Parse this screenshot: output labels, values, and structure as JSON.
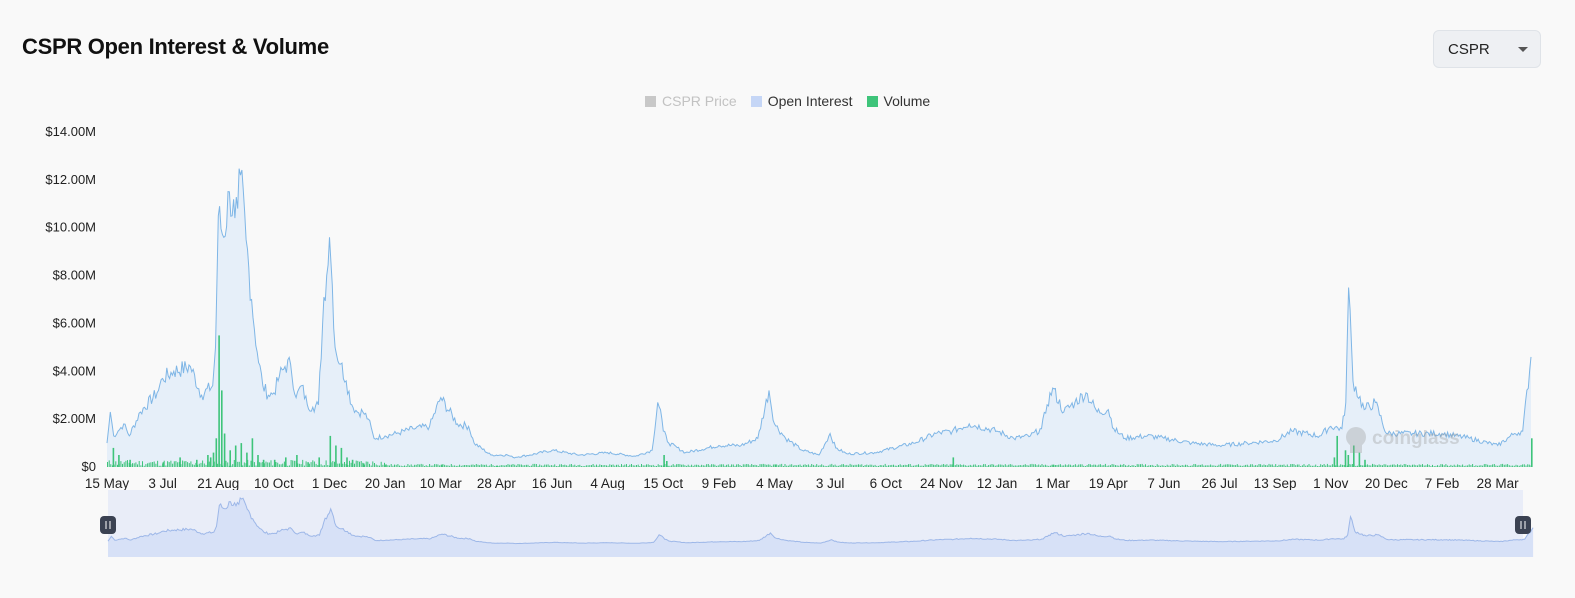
{
  "header": {
    "title": "CSPR Open Interest & Volume"
  },
  "selector": {
    "value": "CSPR"
  },
  "colors": {
    "open_interest_line": "#7fb6e6",
    "open_interest_fill": "#e6eff9",
    "volume": "#3ec47a",
    "price_disabled": "#c8c8c8",
    "legend_oi_swatch": "#c5d6f6",
    "navigator_fill": "#d7e1f7",
    "navigator_bg": "#e9edf8",
    "navigator_handle": "#3b4252"
  },
  "watermark": {
    "text": "coinglass",
    "icon": "coinglass-logo-icon"
  },
  "chart_data": {
    "type": "area",
    "title": "CSPR Open Interest & Volume",
    "legend": {
      "placement": "top-center",
      "items": [
        {
          "label": "CSPR Price",
          "color": "#c8c8c8",
          "visible": false
        },
        {
          "label": "Open Interest",
          "color": "#c5d6f6",
          "visible": true
        },
        {
          "label": "Volume",
          "color": "#3ec47a",
          "visible": true
        }
      ]
    },
    "y_axis": {
      "ticks": [
        "$0",
        "$2.00M",
        "$4.00M",
        "$6.00M",
        "$8.00M",
        "$10.00M",
        "$12.00M",
        "$14.00M"
      ],
      "ylim": [
        0,
        14000000
      ]
    },
    "x_axis": {
      "ticks": [
        "15 May",
        "3 Jul",
        "21 Aug",
        "10 Oct",
        "1 Dec",
        "20 Jan",
        "10 Mar",
        "28 Apr",
        "16 Jun",
        "4 Aug",
        "15 Oct",
        "9 Feb",
        "4 May",
        "3 Jul",
        "6 Oct",
        "24 Nov",
        "12 Jan",
        "1 Mar",
        "19 Apr",
        "7 Jun",
        "26 Jul",
        "13 Sep",
        "1 Nov",
        "20 Dec",
        "7 Feb",
        "28 Mar"
      ]
    },
    "grid": false,
    "navigator": true,
    "series": [
      {
        "name": "Open Interest",
        "type": "area",
        "x_index": [
          0,
          0.06,
          0.12,
          0.2,
          0.3,
          0.4,
          0.6,
          0.9,
          1.0,
          1.2,
          1.5,
          1.7,
          1.9,
          1.95,
          2.0,
          2.1,
          2.2,
          2.3,
          2.35,
          2.4,
          2.5,
          2.6,
          2.7,
          2.8,
          2.9,
          3.0,
          3.1,
          3.2,
          3.3,
          3.4,
          3.5,
          3.6,
          3.7,
          3.8,
          3.9,
          3.95,
          4.0,
          4.05,
          4.1,
          4.2,
          4.3,
          4.4,
          4.5,
          4.6,
          4.7,
          4.8,
          5.0,
          5.2,
          5.5,
          5.8,
          6.0,
          6.3,
          6.5,
          6.6,
          6.9,
          7.2,
          7.3,
          7.6,
          8.0,
          8.5,
          9.0,
          9.5,
          9.8,
          9.9,
          9.95,
          10.0,
          10.1,
          10.4,
          11.0,
          11.4,
          11.7,
          11.9,
          12.0,
          12.2,
          12.5,
          12.8,
          13.0,
          13.1,
          13.3,
          13.8,
          14.5,
          14.9,
          15.2,
          15.5,
          16.0,
          16.3,
          16.6,
          16.8,
          16.9,
          17.0,
          17.2,
          17.4,
          17.6,
          17.8,
          18.0,
          18.1,
          18.3,
          18.7,
          19.0,
          19.5,
          20.0,
          20.5,
          21.0,
          21.3,
          21.8,
          22.0,
          22.2,
          22.27,
          22.32,
          22.4,
          22.6,
          22.8,
          23.0,
          23.5,
          24.0,
          24.5,
          25.0,
          25.3,
          25.45,
          25.6
        ],
        "values": [
          1000000,
          2300000,
          1300000,
          1500000,
          1800000,
          1300000,
          2300000,
          3100000,
          3700000,
          4000000,
          4200000,
          3000000,
          3400000,
          5000000,
          10500000,
          9600000,
          11500000,
          10400000,
          10800000,
          12200000,
          9500000,
          7000000,
          4800000,
          3400000,
          3000000,
          3100000,
          3800000,
          4200000,
          4300000,
          2900000,
          3400000,
          2600000,
          2500000,
          2600000,
          7100000,
          8000000,
          9600000,
          7600000,
          5000000,
          4300000,
          3600000,
          2600000,
          2300000,
          2300000,
          2000000,
          1200000,
          1300000,
          1400000,
          1600000,
          1700000,
          2900000,
          1800000,
          1700000,
          1000000,
          500000,
          500000,
          400000,
          500000,
          700000,
          500000,
          600000,
          450000,
          700000,
          2700000,
          2400000,
          1500000,
          1000000,
          600000,
          900000,
          900000,
          1200000,
          3200000,
          1800000,
          1200000,
          700000,
          500000,
          1400000,
          800000,
          550000,
          600000,
          1000000,
          1400000,
          1500000,
          1800000,
          1500000,
          1200000,
          1300000,
          1600000,
          2600000,
          3300000,
          2300000,
          2700000,
          3100000,
          2300000,
          2400000,
          1600000,
          1200000,
          1300000,
          1200000,
          1000000,
          900000,
          1000000,
          1100000,
          1500000,
          1300000,
          1700000,
          1600000,
          2700000,
          7500000,
          3600000,
          2400000,
          2700000,
          1400000,
          1400000,
          1400000,
          1200000,
          900000,
          1400000,
          1500000,
          4600000
        ]
      },
      {
        "name": "Volume",
        "type": "bar",
        "x_index": [
          0.1,
          0.2,
          0.4,
          1.0,
          1.3,
          1.6,
          1.8,
          1.85,
          1.9,
          1.95,
          2.0,
          2.05,
          2.1,
          2.2,
          2.3,
          2.4,
          2.5,
          2.6,
          2.7,
          2.8,
          3.0,
          3.2,
          3.4,
          3.6,
          3.8,
          4.0,
          4.1,
          4.2,
          4.3,
          4.4,
          4.6,
          5.0,
          6.0,
          7.0,
          10.0,
          10.05,
          12.0,
          15.2,
          17.0,
          22.05,
          22.1,
          22.25,
          22.3,
          22.4,
          22.5,
          22.6,
          25.6
        ],
        "values": [
          800000,
          500000,
          300000,
          200000,
          400000,
          300000,
          500000,
          400000,
          600000,
          1200000,
          5500000,
          3200000,
          1400000,
          700000,
          900000,
          1000000,
          600000,
          1200000,
          500000,
          300000,
          300000,
          400000,
          500000,
          200000,
          400000,
          1300000,
          900000,
          800000,
          400000,
          300000,
          150000,
          100000,
          80000,
          60000,
          500000,
          250000,
          100000,
          400000,
          100000,
          400000,
          1300000,
          700000,
          500000,
          900000,
          600000,
          300000,
          1200000
        ]
      }
    ]
  }
}
